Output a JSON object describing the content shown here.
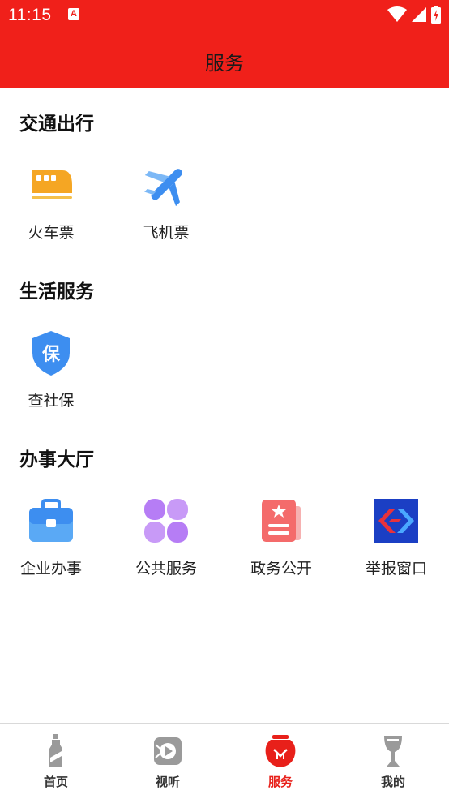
{
  "status_bar": {
    "time": "11:15",
    "notification_icon": "a-notification-icon",
    "icons": [
      "wifi-icon",
      "signal-icon",
      "battery-icon"
    ]
  },
  "header": {
    "title": "服务"
  },
  "sections": [
    {
      "title": "交通出行",
      "items": [
        {
          "label": "火车票",
          "icon": "train-icon"
        },
        {
          "label": "飞机票",
          "icon": "airplane-icon"
        }
      ]
    },
    {
      "title": "生活服务",
      "items": [
        {
          "label": "查社保",
          "icon": "shield-icon"
        }
      ]
    },
    {
      "title": "办事大厅",
      "items": [
        {
          "label": "企业办事",
          "icon": "briefcase-icon"
        },
        {
          "label": "公共服务",
          "icon": "clover-icon"
        },
        {
          "label": "政务公开",
          "icon": "document-icon"
        },
        {
          "label": "举报窗口",
          "icon": "report-icon"
        }
      ]
    }
  ],
  "shield_text": "保",
  "bottom_nav": [
    {
      "label": "首页",
      "icon": "bottle-icon",
      "active": false
    },
    {
      "label": "视听",
      "icon": "play-icon",
      "active": false
    },
    {
      "label": "服务",
      "icon": "jar-icon",
      "active": true
    },
    {
      "label": "我的",
      "icon": "cup-icon",
      "active": false
    }
  ],
  "colors": {
    "brand_red": "#f0201a",
    "active_nav": "#e8201a"
  }
}
